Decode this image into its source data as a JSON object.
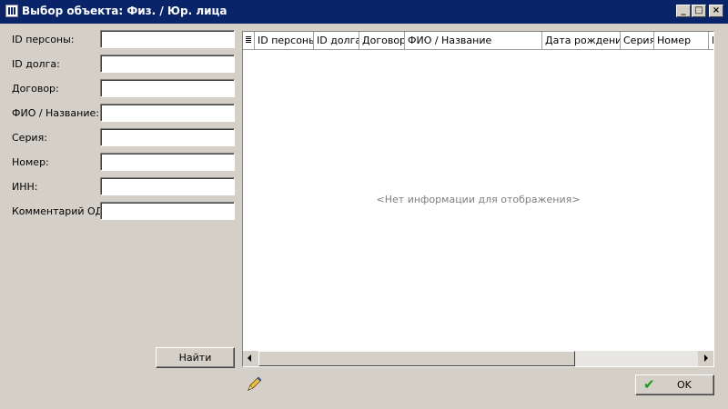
{
  "window": {
    "title": "Выбор объекта: Физ. / Юр. лица",
    "minimize_glyph": "_",
    "maximize_glyph": "□",
    "close_glyph": "×"
  },
  "filters": [
    {
      "label": "ID персоны:",
      "value": ""
    },
    {
      "label": "ID долга:",
      "value": ""
    },
    {
      "label": "Договор:",
      "value": ""
    },
    {
      "label": "ФИО / Название:",
      "value": ""
    },
    {
      "label": "Серия:",
      "value": ""
    },
    {
      "label": "Номер:",
      "value": ""
    },
    {
      "label": "ИНН:",
      "value": ""
    },
    {
      "label": "Комментарий ОД:",
      "value": ""
    }
  ],
  "find_button": "Найти",
  "grid": {
    "columns": [
      "ID персоны",
      "ID долга",
      "Договор",
      "ФИО / Название",
      "Дата рождения",
      "Серия",
      "Номер",
      "I"
    ],
    "empty_text": "<Нет информации для отображения>"
  },
  "ok_button": "OK",
  "icons": {
    "app": "app-icon",
    "column-chooser": "column-chooser-icon",
    "edit": "pencil-icon",
    "ok": "checkmark-icon"
  },
  "colors": {
    "titlebar": "#0a246a",
    "window_bg": "#d4d0c8",
    "ok_check": "#1a9a1a"
  }
}
